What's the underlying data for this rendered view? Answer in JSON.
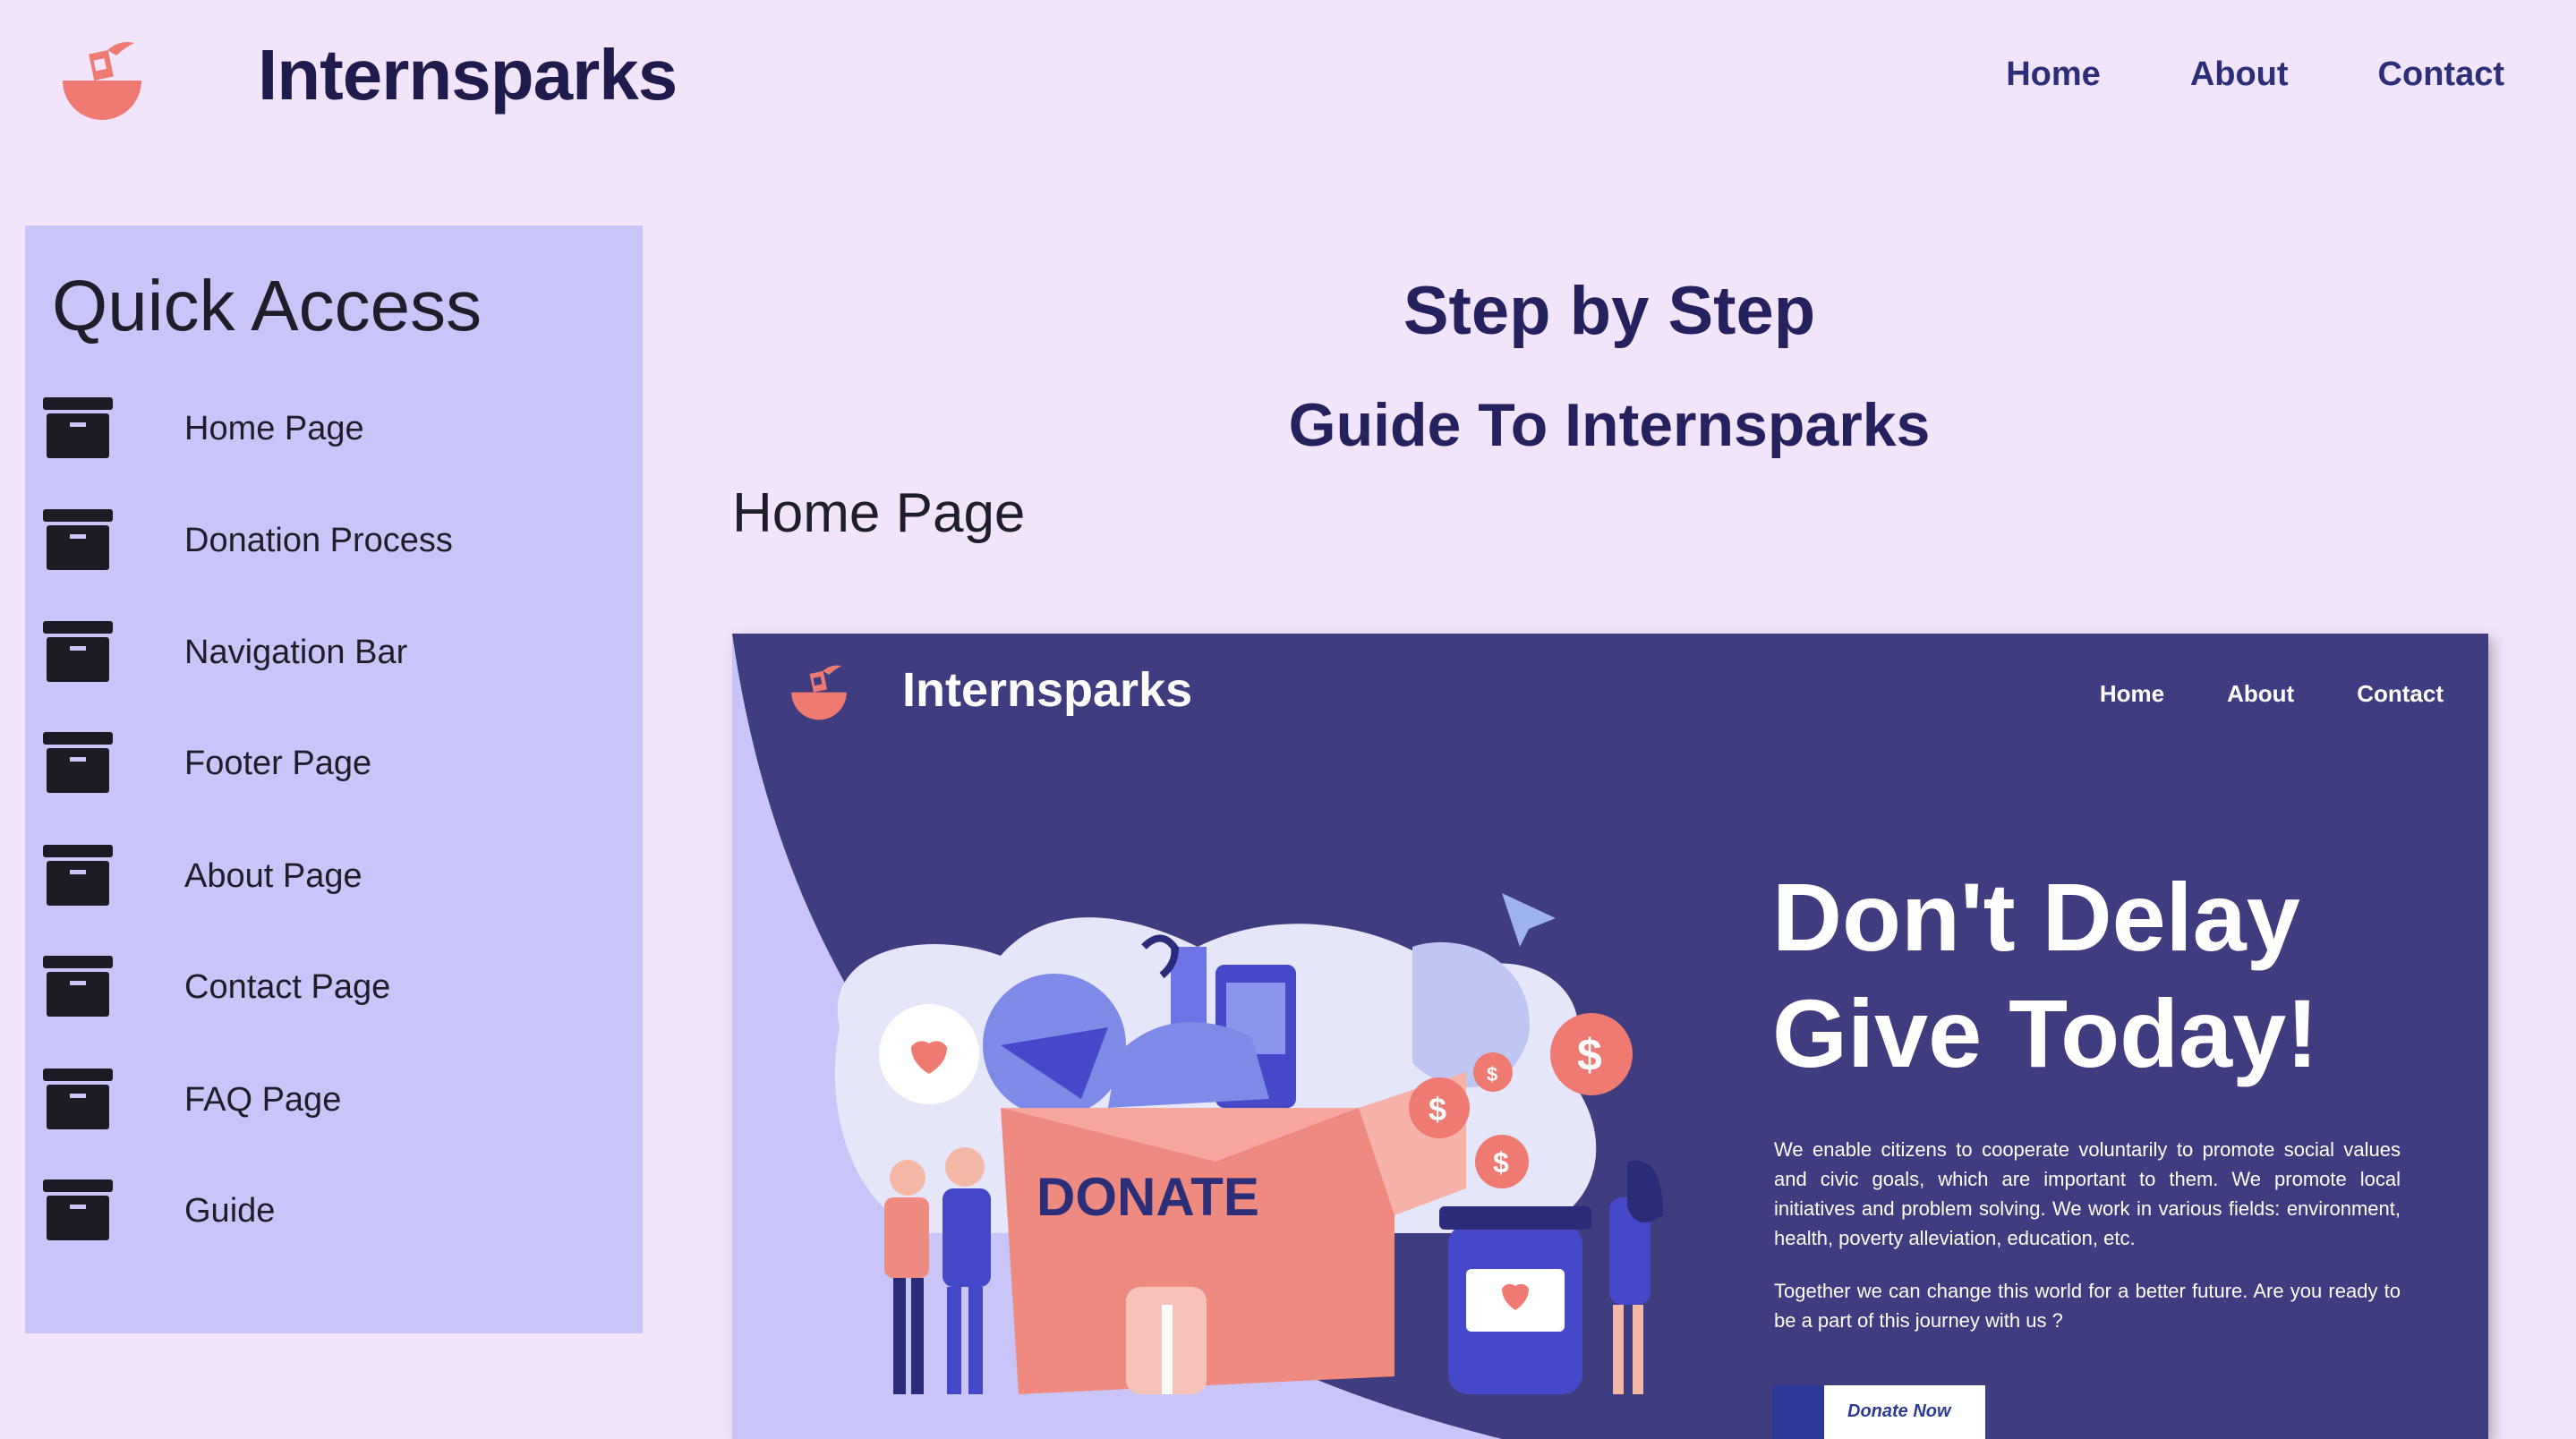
{
  "header": {
    "brand": "Internsparks",
    "nav": [
      "Home",
      "About",
      "Contact"
    ]
  },
  "sidebar": {
    "title": "Quick Access",
    "items": [
      {
        "label": "Home Page",
        "icon": "archive-box-icon"
      },
      {
        "label": "Donation Process",
        "icon": "archive-box-icon"
      },
      {
        "label": "Navigation Bar",
        "icon": "archive-box-icon"
      },
      {
        "label": "Footer Page",
        "icon": "archive-box-icon"
      },
      {
        "label": "About Page",
        "icon": "archive-box-icon"
      },
      {
        "label": "Contact Page",
        "icon": "archive-box-icon"
      },
      {
        "label": "FAQ Page",
        "icon": "archive-box-icon"
      },
      {
        "label": "Guide",
        "icon": "archive-box-icon"
      }
    ]
  },
  "main": {
    "title": "Step by Step",
    "subtitle": "Guide To Internsparks",
    "section_heading": "Home Page"
  },
  "preview": {
    "brand": "Internsparks",
    "nav": [
      "Home",
      "About",
      "Contact"
    ],
    "hero_line1": "Don't Delay",
    "hero_line2": "Give Today!",
    "paragraph1": "We enable citizens to cooperate voluntarily to promote social values and civic goals, which are important to them. We promote local initiatives and problem solving. We work in various fields: environment, health, poverty alleviation, education, etc.",
    "paragraph2": "Together we can change this world for a better future. Are you ready to be a part of this journey with us ?",
    "donate_button": "Donate Now",
    "illustration_text": "DONATE"
  },
  "colors": {
    "page_bg": "#f1e4fb",
    "sidebar_bg": "#c9c5f8",
    "heading": "#24215e",
    "preview_bg": "#3f3c80",
    "accent_coral": "#ee7a72"
  }
}
